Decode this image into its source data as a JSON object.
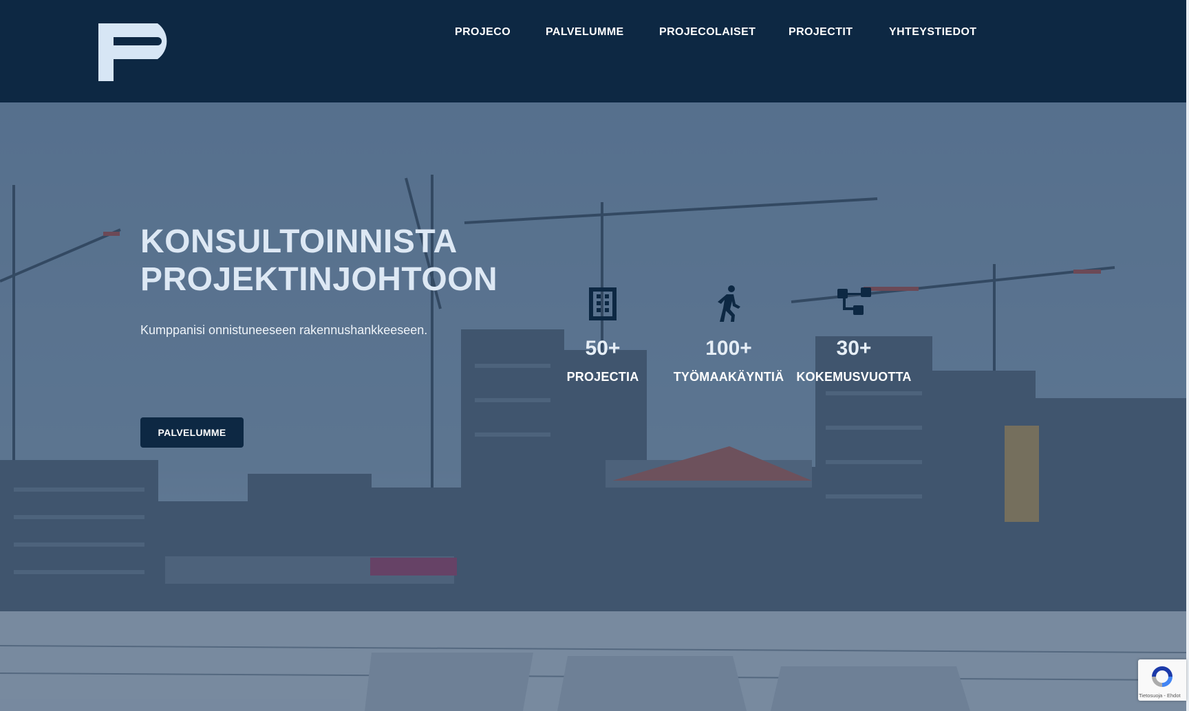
{
  "header": {
    "logo_alt": "P",
    "nav": [
      "PROJECO",
      "PALVELUMME",
      "PROJECOLAISET",
      "PROJECTIT",
      "YHTEYSTIEDOT"
    ]
  },
  "hero": {
    "title_line1": "KONSULTOINNISTA",
    "title_line2": "PROJEKTINJOHTOON",
    "subtitle": "Kumppanisi onnistuneeseen rakennushankkeeseen.",
    "cta_label": "PALVELUMME",
    "stats": [
      {
        "icon": "building-icon",
        "value": "50+",
        "label": "PROJECTIA"
      },
      {
        "icon": "walking-person-icon",
        "value": "100+",
        "label": "TYÖMAAKÄYNTIÄ"
      },
      {
        "icon": "flowchart-icon",
        "value": "30+",
        "label": "KOKEMUSVUOTTA"
      }
    ]
  },
  "recaptcha": {
    "text": "Tietosuoja - Ehdot"
  },
  "colors": {
    "header": "#0d2843",
    "title": "#dde8f4",
    "button": "#0d2843"
  }
}
